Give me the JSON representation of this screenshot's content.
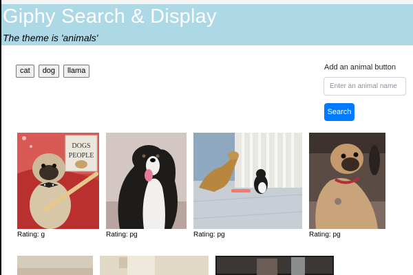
{
  "header": {
    "title": "Giphy Search & Display",
    "subtitle": "The theme is 'animals'"
  },
  "animal_buttons": [
    "cat",
    "dog",
    "llama"
  ],
  "form": {
    "label": "Add an animal button",
    "placeholder": "Enter an animal name",
    "submit_label": "Search"
  },
  "gifs": [
    {
      "rating_label": "Rating:",
      "rating": "g"
    },
    {
      "rating_label": "Rating:",
      "rating": "pg"
    },
    {
      "rating_label": "Rating:",
      "rating": "pg"
    },
    {
      "rating_label": "Rating:",
      "rating": "pg"
    }
  ],
  "gif_art_lettering": {
    "book_cover": "DOGS PEOPLE"
  },
  "colors": {
    "header_bg": "#add8e6",
    "header_title": "#ffffff",
    "primary_button": "#007bff"
  }
}
